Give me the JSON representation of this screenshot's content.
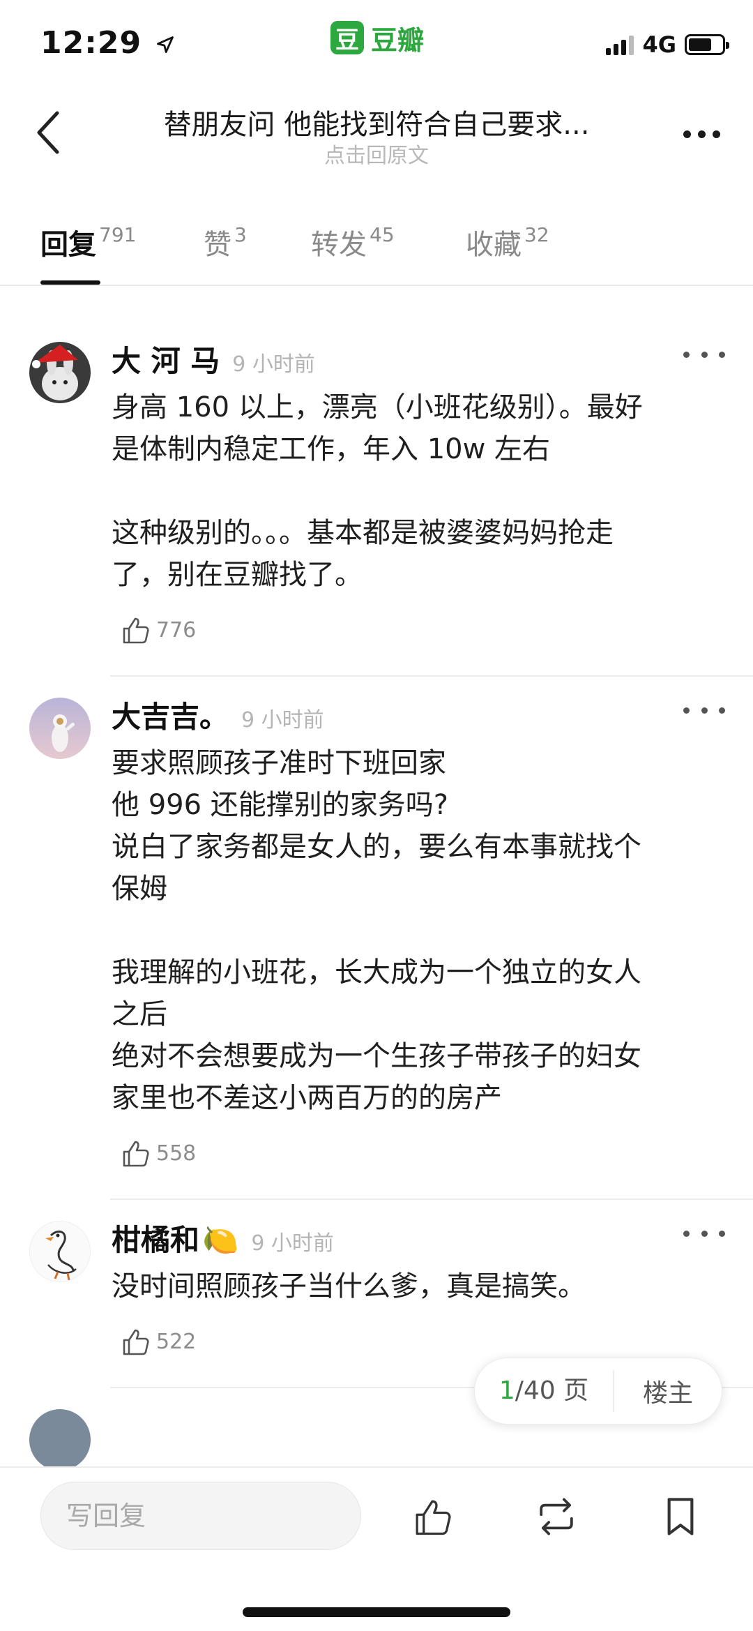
{
  "status_bar": {
    "time": "12:29",
    "app_name": "豆瓣",
    "app_logo_char": "豆",
    "network": "4G",
    "brand_color": "#2ca83f"
  },
  "header": {
    "title": "替朋友问  他能找到符合自己要求...",
    "subtitle": "点击回原文"
  },
  "tabs": [
    {
      "label": "回复",
      "count": "791",
      "active": true
    },
    {
      "label": "赞",
      "count": "3",
      "active": false
    },
    {
      "label": "转发",
      "count": "45",
      "active": false
    },
    {
      "label": "收藏",
      "count": "32",
      "active": false
    }
  ],
  "comments": [
    {
      "name": "大 河 马",
      "time": "9 小时前",
      "body": "身高 160 以上，漂亮（小班花级别）。最好\n是体制内稳定工作，年入 10w 左右\n\n这种级别的。。。基本都是被婆婆妈妈抢走\n了，别在豆瓣找了。",
      "likes": "776",
      "avatar": "rabbit-santa-hat"
    },
    {
      "name": "大吉吉。",
      "time": "9 小时前",
      "body": "要求照顾孩子准时下班回家\n他 996 还能撑别的家务吗?\n说白了家务都是女人的，要么有本事就找个\n保姆\n\n我理解的小班花，长大成为一个独立的女人\n之后\n绝对不会想要成为一个生孩子带孩子的妇女\n家里也不差这小两百万的的房产",
      "likes": "558",
      "avatar": "astronaut"
    },
    {
      "name": "柑橘和",
      "name_emoji": "🍋",
      "time": "9 小时前",
      "body": "没时间照顾孩子当什么爹，真是搞笑。",
      "likes": "522",
      "avatar": "goose-sketch"
    }
  ],
  "pager": {
    "current": "1",
    "total_label": "/40 页",
    "op_label": "楼主"
  },
  "bottom_bar": {
    "reply_placeholder": "写回复"
  }
}
